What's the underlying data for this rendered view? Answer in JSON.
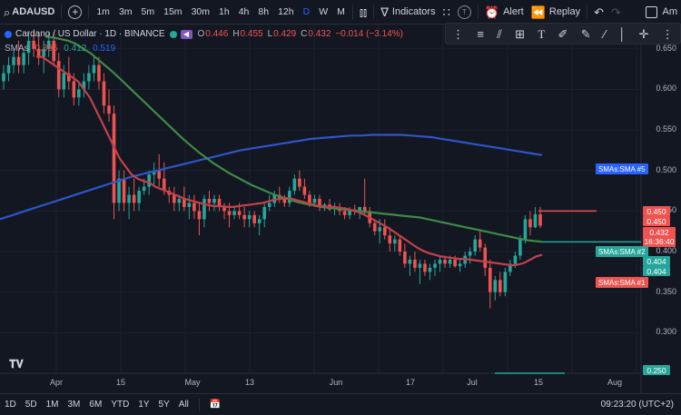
{
  "toolbar": {
    "symbol": "ADAUSD",
    "timeframes": [
      "1m",
      "3m",
      "5m",
      "15m",
      "30m",
      "1h",
      "4h",
      "8h",
      "12h",
      "D",
      "W",
      "M"
    ],
    "active_timeframe": "D",
    "indicators_label": "Indicators",
    "alert_label": "Alert",
    "replay_label": "Replay",
    "right_cut_label": "Am"
  },
  "legend": {
    "title": "Cardano / US Dollar · 1D · BINANCE",
    "open_label": "O",
    "open": "0.446",
    "high_label": "H",
    "high": "0.455",
    "low_label": "L",
    "low": "0.429",
    "close_label": "C",
    "close": "0.432",
    "change": "−0.014 (−3.14%)",
    "sma_label": "SMAs",
    "sma_values": [
      "0.396",
      "0.412",
      "0.519"
    ],
    "sma_colors": [
      "#ef5350",
      "#26a69a",
      "#2962ff"
    ]
  },
  "price_axis": {
    "ticks": [
      "0.650",
      "0.600",
      "0.550",
      "0.500",
      "0.450",
      "0.400",
      "0.350",
      "0.300"
    ],
    "high_badge": "0.450",
    "open_badge": "0.450",
    "current_price": "0.432",
    "countdown": "16:36:40",
    "sma2_badge": "0.404",
    "sma1_badge": "0.404",
    "low_badge": "0.250"
  },
  "sma_tags": {
    "sma5": "SMAs:SMA #5",
    "sma2": "SMAs:SMA #2",
    "sma1": "SMAs:SMA #1"
  },
  "time_axis": [
    "Apr",
    "15",
    "May",
    "13",
    "Jun",
    "17",
    "Jul",
    "15",
    "Aug"
  ],
  "bottom_bar": {
    "ranges": [
      "1D",
      "5D",
      "1M",
      "3M",
      "6M",
      "YTD",
      "1Y",
      "5Y",
      "All"
    ],
    "clock": "09:23:20 (UTC+2)"
  },
  "colors": {
    "up": "#26a69a",
    "down": "#ef5350",
    "sma_fast": "#c2414b",
    "sma_mid": "#3d8b46",
    "sma_slow": "#2d56c8"
  },
  "chart_data": {
    "type": "line",
    "ylim": [
      0.25,
      0.68
    ],
    "candles": [
      [
        0.61,
        0.63,
        0.6,
        0.62
      ],
      [
        0.62,
        0.64,
        0.61,
        0.63
      ],
      [
        0.63,
        0.65,
        0.62,
        0.64
      ],
      [
        0.64,
        0.66,
        0.62,
        0.63
      ],
      [
        0.63,
        0.65,
        0.62,
        0.645
      ],
      [
        0.645,
        0.67,
        0.63,
        0.66
      ],
      [
        0.66,
        0.67,
        0.64,
        0.65
      ],
      [
        0.65,
        0.67,
        0.63,
        0.64
      ],
      [
        0.64,
        0.66,
        0.62,
        0.65
      ],
      [
        0.65,
        0.67,
        0.64,
        0.66
      ],
      [
        0.66,
        0.67,
        0.63,
        0.635
      ],
      [
        0.635,
        0.645,
        0.59,
        0.6
      ],
      [
        0.6,
        0.63,
        0.59,
        0.62
      ],
      [
        0.62,
        0.64,
        0.6,
        0.61
      ],
      [
        0.61,
        0.62,
        0.58,
        0.59
      ],
      [
        0.59,
        0.61,
        0.58,
        0.6
      ],
      [
        0.6,
        0.62,
        0.59,
        0.61
      ],
      [
        0.61,
        0.63,
        0.6,
        0.62
      ],
      [
        0.62,
        0.64,
        0.61,
        0.63
      ],
      [
        0.63,
        0.64,
        0.6,
        0.61
      ],
      [
        0.61,
        0.62,
        0.57,
        0.58
      ],
      [
        0.58,
        0.6,
        0.56,
        0.57
      ],
      [
        0.57,
        0.58,
        0.44,
        0.46
      ],
      [
        0.46,
        0.5,
        0.45,
        0.49
      ],
      [
        0.49,
        0.5,
        0.45,
        0.46
      ],
      [
        0.46,
        0.48,
        0.44,
        0.47
      ],
      [
        0.47,
        0.49,
        0.45,
        0.46
      ],
      [
        0.46,
        0.48,
        0.45,
        0.475
      ],
      [
        0.475,
        0.49,
        0.47,
        0.48
      ],
      [
        0.48,
        0.5,
        0.47,
        0.495
      ],
      [
        0.495,
        0.51,
        0.48,
        0.5
      ],
      [
        0.5,
        0.52,
        0.48,
        0.49
      ],
      [
        0.49,
        0.51,
        0.47,
        0.475
      ],
      [
        0.475,
        0.48,
        0.46,
        0.47
      ],
      [
        0.47,
        0.48,
        0.45,
        0.46
      ],
      [
        0.46,
        0.47,
        0.45,
        0.465
      ],
      [
        0.465,
        0.48,
        0.45,
        0.455
      ],
      [
        0.455,
        0.47,
        0.44,
        0.46
      ],
      [
        0.46,
        0.47,
        0.44,
        0.45
      ],
      [
        0.45,
        0.46,
        0.42,
        0.44
      ],
      [
        0.44,
        0.47,
        0.43,
        0.465
      ],
      [
        0.465,
        0.475,
        0.45,
        0.46
      ],
      [
        0.46,
        0.47,
        0.45,
        0.465
      ],
      [
        0.465,
        0.47,
        0.45,
        0.455
      ],
      [
        0.455,
        0.46,
        0.44,
        0.45
      ],
      [
        0.45,
        0.46,
        0.43,
        0.445
      ],
      [
        0.445,
        0.455,
        0.44,
        0.45
      ],
      [
        0.45,
        0.46,
        0.44,
        0.445
      ],
      [
        0.445,
        0.455,
        0.43,
        0.44
      ],
      [
        0.44,
        0.45,
        0.43,
        0.445
      ],
      [
        0.445,
        0.45,
        0.43,
        0.435
      ],
      [
        0.435,
        0.445,
        0.42,
        0.44
      ],
      [
        0.44,
        0.46,
        0.43,
        0.455
      ],
      [
        0.455,
        0.47,
        0.45,
        0.46
      ],
      [
        0.46,
        0.475,
        0.455,
        0.47
      ],
      [
        0.47,
        0.48,
        0.46,
        0.465
      ],
      [
        0.465,
        0.47,
        0.455,
        0.46
      ],
      [
        0.46,
        0.48,
        0.455,
        0.475
      ],
      [
        0.475,
        0.495,
        0.47,
        0.49
      ],
      [
        0.49,
        0.5,
        0.475,
        0.48
      ],
      [
        0.48,
        0.49,
        0.465,
        0.47
      ],
      [
        0.47,
        0.475,
        0.455,
        0.46
      ],
      [
        0.46,
        0.47,
        0.455,
        0.465
      ],
      [
        0.465,
        0.47,
        0.45,
        0.455
      ],
      [
        0.455,
        0.46,
        0.45,
        0.458
      ],
      [
        0.458,
        0.465,
        0.45,
        0.452
      ],
      [
        0.452,
        0.46,
        0.445,
        0.455
      ],
      [
        0.455,
        0.46,
        0.445,
        0.45
      ],
      [
        0.45,
        0.455,
        0.44,
        0.445
      ],
      [
        0.445,
        0.455,
        0.44,
        0.452
      ],
      [
        0.452,
        0.458,
        0.445,
        0.45
      ],
      [
        0.45,
        0.455,
        0.44,
        0.455
      ],
      [
        0.455,
        0.49,
        0.445,
        0.45
      ],
      [
        0.45,
        0.455,
        0.43,
        0.435
      ],
      [
        0.435,
        0.44,
        0.42,
        0.425
      ],
      [
        0.425,
        0.44,
        0.41,
        0.43
      ],
      [
        0.43,
        0.44,
        0.415,
        0.42
      ],
      [
        0.42,
        0.43,
        0.4,
        0.41
      ],
      [
        0.41,
        0.42,
        0.4,
        0.415
      ],
      [
        0.415,
        0.42,
        0.395,
        0.4
      ],
      [
        0.4,
        0.41,
        0.38,
        0.385
      ],
      [
        0.385,
        0.395,
        0.37,
        0.39
      ],
      [
        0.39,
        0.4,
        0.375,
        0.38
      ],
      [
        0.38,
        0.39,
        0.36,
        0.385
      ],
      [
        0.385,
        0.39,
        0.37,
        0.375
      ],
      [
        0.375,
        0.385,
        0.365,
        0.38
      ],
      [
        0.38,
        0.39,
        0.37,
        0.385
      ],
      [
        0.385,
        0.395,
        0.375,
        0.39
      ],
      [
        0.39,
        0.395,
        0.38,
        0.385
      ],
      [
        0.385,
        0.395,
        0.38,
        0.39
      ],
      [
        0.39,
        0.395,
        0.38,
        0.382
      ],
      [
        0.382,
        0.39,
        0.375,
        0.385
      ],
      [
        0.385,
        0.4,
        0.38,
        0.395
      ],
      [
        0.395,
        0.405,
        0.385,
        0.4
      ],
      [
        0.4,
        0.42,
        0.395,
        0.415
      ],
      [
        0.415,
        0.425,
        0.4,
        0.405
      ],
      [
        0.405,
        0.41,
        0.37,
        0.38
      ],
      [
        0.38,
        0.39,
        0.33,
        0.35
      ],
      [
        0.35,
        0.37,
        0.34,
        0.365
      ],
      [
        0.365,
        0.375,
        0.345,
        0.35
      ],
      [
        0.35,
        0.38,
        0.345,
        0.375
      ],
      [
        0.375,
        0.39,
        0.37,
        0.385
      ],
      [
        0.385,
        0.4,
        0.38,
        0.395
      ],
      [
        0.395,
        0.42,
        0.39,
        0.415
      ],
      [
        0.415,
        0.445,
        0.41,
        0.44
      ],
      [
        0.44,
        0.45,
        0.42,
        0.43
      ],
      [
        0.43,
        0.455,
        0.429,
        0.446
      ],
      [
        0.446,
        0.455,
        0.429,
        0.432
      ]
    ],
    "sma_fast": [
      0.64,
      0.64,
      0.635,
      0.63,
      0.625,
      0.62,
      0.615,
      0.61,
      0.6,
      0.59,
      0.575,
      0.56,
      0.545,
      0.53,
      0.515,
      0.505,
      0.495,
      0.49,
      0.487,
      0.485,
      0.48,
      0.477,
      0.474,
      0.471,
      0.468,
      0.465,
      0.463,
      0.461,
      0.459,
      0.457,
      0.456,
      0.456,
      0.455,
      0.455,
      0.456,
      0.457,
      0.458,
      0.459,
      0.46,
      0.462,
      0.464,
      0.465,
      0.466,
      0.465,
      0.463,
      0.461,
      0.459,
      0.457,
      0.456,
      0.455,
      0.455,
      0.454,
      0.453,
      0.451,
      0.449,
      0.446,
      0.442,
      0.438,
      0.434,
      0.43,
      0.425,
      0.42,
      0.415,
      0.41,
      0.405,
      0.401,
      0.398,
      0.396,
      0.394,
      0.393,
      0.392,
      0.391,
      0.391,
      0.39,
      0.389,
      0.388,
      0.387,
      0.386,
      0.385,
      0.384,
      0.383,
      0.384,
      0.386,
      0.39,
      0.394,
      0.396
    ],
    "sma_mid": [
      0.665,
      0.664,
      0.662,
      0.66,
      0.656,
      0.65,
      0.644,
      0.636,
      0.628,
      0.62,
      0.611,
      0.602,
      0.593,
      0.584,
      0.575,
      0.566,
      0.557,
      0.548,
      0.539,
      0.531,
      0.523,
      0.516,
      0.509,
      0.503,
      0.497,
      0.492,
      0.487,
      0.482,
      0.478,
      0.474,
      0.47,
      0.467,
      0.464,
      0.461,
      0.459,
      0.457,
      0.455,
      0.454,
      0.453,
      0.452,
      0.451,
      0.45,
      0.449,
      0.448,
      0.447,
      0.446,
      0.445,
      0.444,
      0.443,
      0.442,
      0.44,
      0.438,
      0.436,
      0.434,
      0.432,
      0.43,
      0.428,
      0.426,
      0.424,
      0.422,
      0.42,
      0.418,
      0.416,
      0.414,
      0.413,
      0.412
    ],
    "sma_slow": [
      0.44,
      0.444,
      0.448,
      0.452,
      0.456,
      0.46,
      0.464,
      0.468,
      0.472,
      0.476,
      0.48,
      0.484,
      0.488,
      0.492,
      0.495,
      0.498,
      0.501,
      0.504,
      0.507,
      0.51,
      0.513,
      0.516,
      0.519,
      0.522,
      0.525,
      0.527,
      0.529,
      0.531,
      0.533,
      0.535,
      0.537,
      0.539,
      0.54,
      0.541,
      0.542,
      0.543,
      0.543,
      0.544,
      0.544,
      0.544,
      0.544,
      0.543,
      0.542,
      0.541,
      0.539,
      0.537,
      0.535,
      0.533,
      0.531,
      0.529,
      0.527,
      0.525,
      0.523,
      0.521,
      0.519
    ]
  }
}
